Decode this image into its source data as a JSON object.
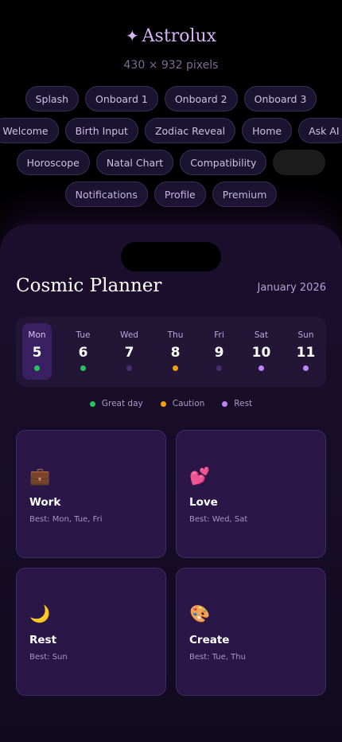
{
  "header": {
    "brand_star": "✦",
    "brand_name": "Astrolux",
    "dimensions": "430 × 932 pixels"
  },
  "screens": {
    "rows": [
      [
        "Splash",
        "Onboard 1",
        "Onboard 2",
        "Onboard 3"
      ],
      [
        "Welcome",
        "Birth Input",
        "Zodiac Reveal",
        "Home",
        "Ask AI"
      ],
      [
        "Horoscope",
        "Natal Chart",
        "Compatibility",
        ""
      ],
      [
        "Notifications",
        "Profile",
        "Premium"
      ]
    ]
  },
  "planner": {
    "title": "Cosmic Planner",
    "month": "January 2026",
    "days": [
      {
        "name": "Mon",
        "num": "5",
        "status": "great",
        "active": true
      },
      {
        "name": "Tue",
        "num": "6",
        "status": "great",
        "active": false
      },
      {
        "name": "Wed",
        "num": "7",
        "status": "neutral",
        "active": false
      },
      {
        "name": "Thu",
        "num": "8",
        "status": "caution",
        "active": false
      },
      {
        "name": "Fri",
        "num": "9",
        "status": "neutral",
        "active": false
      },
      {
        "name": "Sat",
        "num": "10",
        "status": "rest",
        "active": false
      },
      {
        "name": "Sun",
        "num": "11",
        "status": "rest",
        "active": false
      }
    ],
    "legend": [
      {
        "label": "Great day",
        "status": "great"
      },
      {
        "label": "Caution",
        "status": "caution"
      },
      {
        "label": "Rest",
        "status": "rest"
      }
    ],
    "status_colors": {
      "great": "#22c55e",
      "caution": "#f59e0b",
      "rest": "#c084fc",
      "neutral": "#4a2c72"
    },
    "cards": [
      {
        "emoji": "💼",
        "icon": "briefcase-icon",
        "name": "Work",
        "best": "Best: Mon, Tue, Fri"
      },
      {
        "emoji": "💕",
        "icon": "hearts-icon",
        "name": "Love",
        "best": "Best: Wed, Sat"
      },
      {
        "emoji": "🌙",
        "icon": "crescent-moon-icon",
        "name": "Rest",
        "best": "Best: Sun"
      },
      {
        "emoji": "🎨",
        "icon": "palette-icon",
        "name": "Create",
        "best": "Best: Tue, Thu"
      }
    ]
  }
}
